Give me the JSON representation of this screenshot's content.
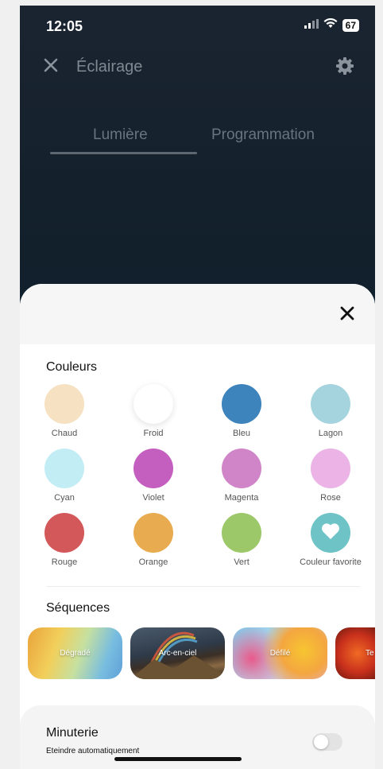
{
  "status": {
    "time": "12:05",
    "battery": "67"
  },
  "header": {
    "title": "Éclairage"
  },
  "tabs": [
    {
      "label": "Lumière",
      "active": true
    },
    {
      "label": "Programmation",
      "active": false
    }
  ],
  "colors_section": {
    "title": "Couleurs",
    "items": [
      {
        "label": "Chaud",
        "color": "#f6e2c2"
      },
      {
        "label": "Froid",
        "color": "#ffffff"
      },
      {
        "label": "Bleu",
        "color": "#3d83bc"
      },
      {
        "label": "Lagon",
        "color": "#a5d4df"
      },
      {
        "label": "Cyan",
        "color": "#c3edf5"
      },
      {
        "label": "Violet",
        "color": "#c45fc0"
      },
      {
        "label": "Magenta",
        "color": "#cf85c7"
      },
      {
        "label": "Rose",
        "color": "#ebb3e6"
      },
      {
        "label": "Rouge",
        "color": "#d35859"
      },
      {
        "label": "Orange",
        "color": "#e8ab4f"
      },
      {
        "label": "Vert",
        "color": "#9cc86a"
      },
      {
        "label": "Couleur favorite",
        "color": "#6ec3c6",
        "icon": "heart-icon"
      }
    ]
  },
  "sequences_section": {
    "title": "Séquences",
    "items": [
      {
        "label": "Dégradé"
      },
      {
        "label": "Arc-en-ciel"
      },
      {
        "label": "Défilé"
      },
      {
        "label": "Te"
      }
    ]
  },
  "timer": {
    "title": "Minuterie",
    "subtitle": "Eteindre automatiquement",
    "enabled": false
  }
}
